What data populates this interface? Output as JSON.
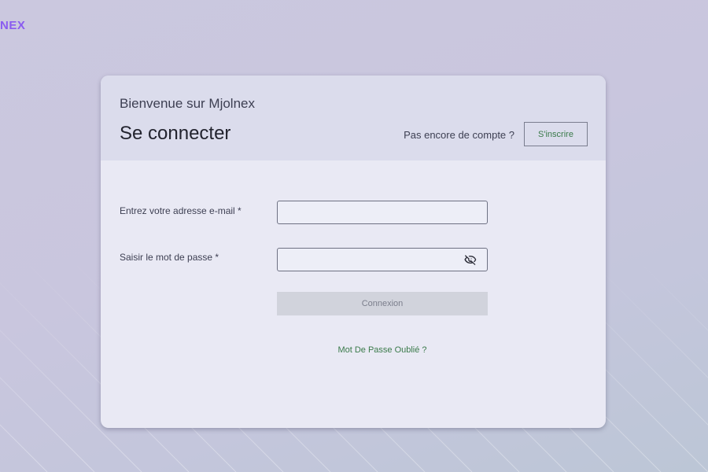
{
  "brand": {
    "logo_text": "NEX",
    "color": "#8a5cf0"
  },
  "header": {
    "welcome": "Bienvenue sur Mjolnex",
    "title": "Se connecter",
    "no_account_text": "Pas encore de compte ?",
    "signup_label": "S'inscrire"
  },
  "form": {
    "email_label": "Entrez votre adresse e-mail *",
    "email_value": "",
    "password_label": "Saisir le mot de passe *",
    "password_value": "",
    "password_toggle_icon": "eye-off-icon",
    "submit_label": "Connexion",
    "forgot_label": "Mot De Passe Oublié ?"
  },
  "colors": {
    "accent_green": "#3a7a4a",
    "button_disabled": "#d1d3dc",
    "card_bg": "#e9e9f4",
    "header_bg": "#dbdcec"
  }
}
